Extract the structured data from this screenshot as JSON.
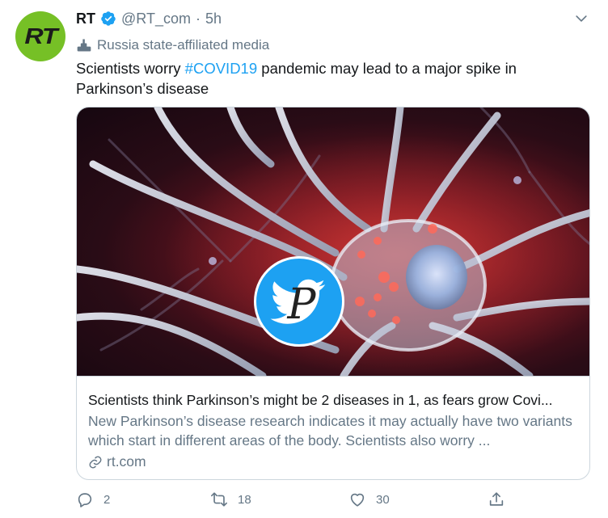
{
  "tweet": {
    "avatar_text": "RT",
    "name": "RT",
    "handle": "@RT_com",
    "separator": "·",
    "time": "5h",
    "label": "Russia state-affiliated media",
    "text_before": "Scientists worry ",
    "hashtag": "#COVID19",
    "text_after": " pandemic may lead to a major spike in Parkinson’s disease"
  },
  "card": {
    "title": "Scientists think Parkinson’s might be 2 diseases in 1, as fears grow Covi...",
    "description": "New Parkinson’s disease research indicates it may actually have two variants which start in different areas of the body. Scientists also worry ...",
    "domain": "rt.com",
    "overlay_letter": "P"
  },
  "actions": {
    "reply_count": "2",
    "retweet_count": "18",
    "like_count": "30"
  },
  "icons": {
    "verified": "verified-badge-icon",
    "chevron": "chevron-down-icon",
    "label": "state-media-icon",
    "link": "link-icon",
    "reply": "reply-icon",
    "retweet": "retweet-icon",
    "like": "heart-icon",
    "share": "share-icon"
  },
  "colors": {
    "accent": "#1da1f2",
    "avatar_bg": "#76c026",
    "muted": "#657786",
    "text": "#14171a",
    "border": "#ccd6dd"
  }
}
